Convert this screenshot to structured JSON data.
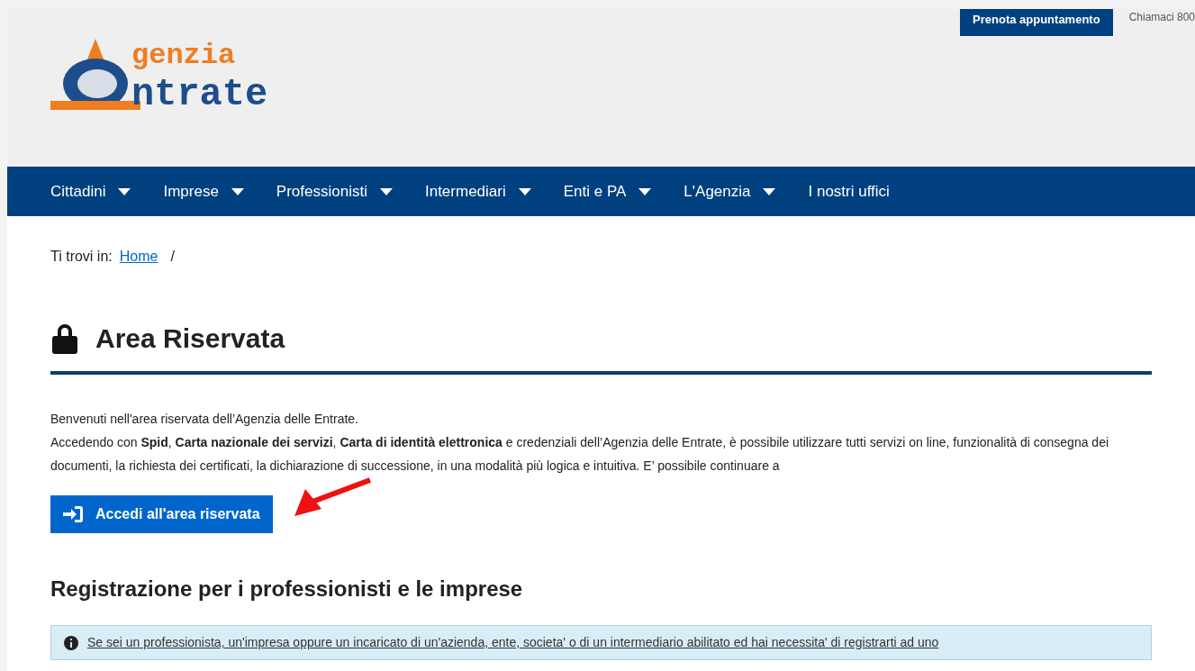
{
  "top_bar": {
    "appointment_button": "Prenota appuntamento",
    "phone": "Chiamaci 800"
  },
  "logo": {
    "line_1": "genzia",
    "line_2": "ntrate"
  },
  "nav": [
    {
      "label": "Cittadini",
      "has_menu": true
    },
    {
      "label": "Imprese",
      "has_menu": true
    },
    {
      "label": "Professionisti",
      "has_menu": true
    },
    {
      "label": "Intermediari",
      "has_menu": true
    },
    {
      "label": "Enti e PA",
      "has_menu": true
    },
    {
      "label": "L'Agenzia",
      "has_menu": true
    },
    {
      "label": "I nostri uffici",
      "has_menu": false
    }
  ],
  "breadcrumb": {
    "prefix": "Ti trovi in:",
    "links": [
      "Home"
    ],
    "separator": "/"
  },
  "page_title": "Area Riservata",
  "intro": [
    "Benvenuti nell'area riservata dell’Agenzia delle Entrate.",
    "Accedendo con **Spid**, **Carta nazionale dei servizi**, **Carta di identità elettronica** e credenziali dell’Agenzia delle Entrate, è possibile utilizzare tutti servizi on line, funzionalità di consegna dei documenti, la richiesta dei certificati, la dichiarazione di successione, in una modalità più logica e intuitiva. E’ possibile continuare a"
  ],
  "login_button": "Accedi all'area riservata",
  "section_title": "Registrazione per i professionisti e le imprese",
  "info_box": "Se sei un professionista, un'impresa oppure un incaricato di un'azienda, ente, societa' o di un intermediario abilitato ed hai necessita' di registrarti ad uno"
}
